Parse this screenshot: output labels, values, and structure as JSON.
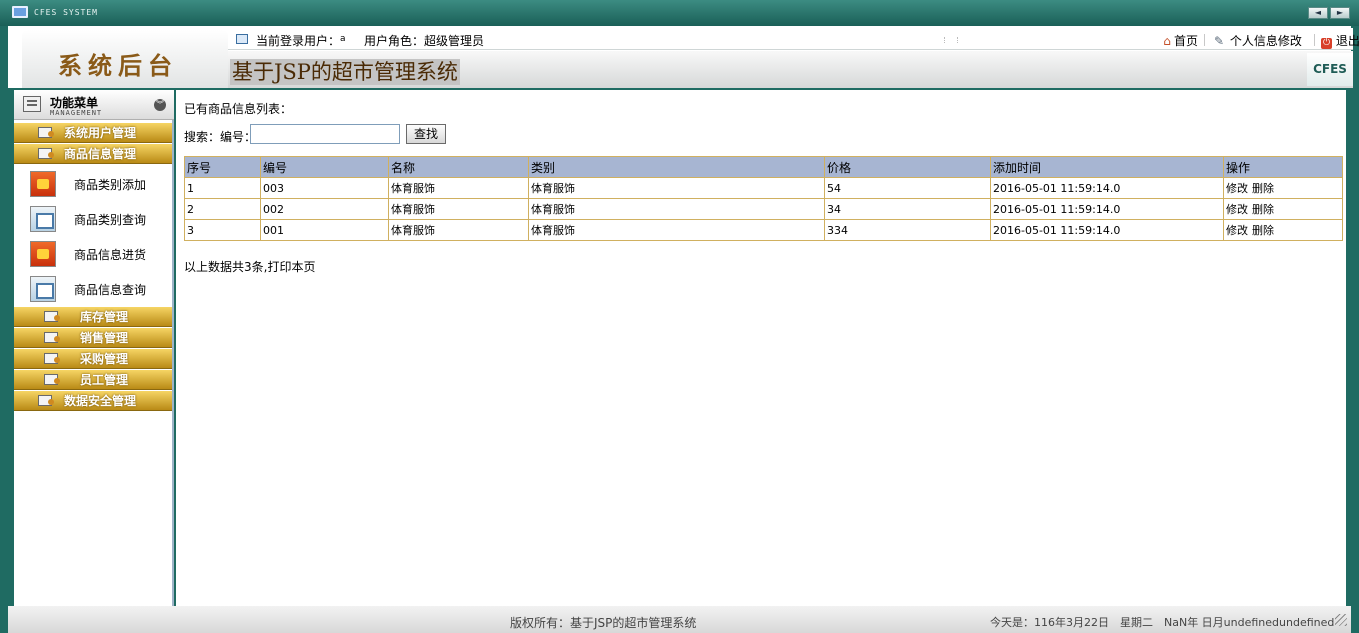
{
  "window": {
    "title": "CFES SYSTEM",
    "nav_prev": "◄",
    "nav_next": "►"
  },
  "header": {
    "logo": "系统后台",
    "system_title": "基于JSP的超市管理系统",
    "badge": "CFES",
    "user_label": "当前登录用户：",
    "user_value": "a",
    "role_label": "用户角色：",
    "role_value": "超级管理员",
    "links": {
      "home": "首页",
      "profile": "个人信息修改",
      "logout": "退出"
    }
  },
  "sidebar": {
    "title": "功能菜单",
    "subtitle": "MANAGEMENT",
    "menu": [
      {
        "label": "系统用户管理"
      },
      {
        "label": "商品信息管理"
      },
      {
        "label": "库存管理"
      },
      {
        "label": "销售管理"
      },
      {
        "label": "采购管理"
      },
      {
        "label": "员工管理"
      },
      {
        "label": "数据安全管理"
      }
    ],
    "sub_items": [
      {
        "label": "商品类别添加"
      },
      {
        "label": "商品类别查询"
      },
      {
        "label": "商品信息进货"
      },
      {
        "label": "商品信息查询"
      }
    ]
  },
  "main": {
    "caption": "已有商品信息列表：",
    "search_label": "搜索：编号：",
    "search_value": "",
    "search_button": "查找",
    "columns": [
      "序号",
      "编号",
      "名称",
      "类别",
      "价格",
      "添加时间",
      "操作"
    ],
    "rows": [
      [
        "1",
        "003",
        "体育服饰",
        "体育服饰",
        "54",
        "2016-05-01 11:59:14.0"
      ],
      [
        "2",
        "002",
        "体育服饰",
        "体育服饰",
        "34",
        "2016-05-01 11:59:14.0"
      ],
      [
        "3",
        "001",
        "体育服饰",
        "体育服饰",
        "334",
        "2016-05-01 11:59:14.0"
      ]
    ],
    "edit_label": "修改",
    "delete_label": "删除",
    "summary": "以上数据共3条,",
    "print_label": "打印本页"
  },
  "status": {
    "copyright": "版权所有：基于JSP的超市管理系统",
    "date": "今天是：116年3月22日　星期二　NaN年 日月undefinedundefined"
  }
}
